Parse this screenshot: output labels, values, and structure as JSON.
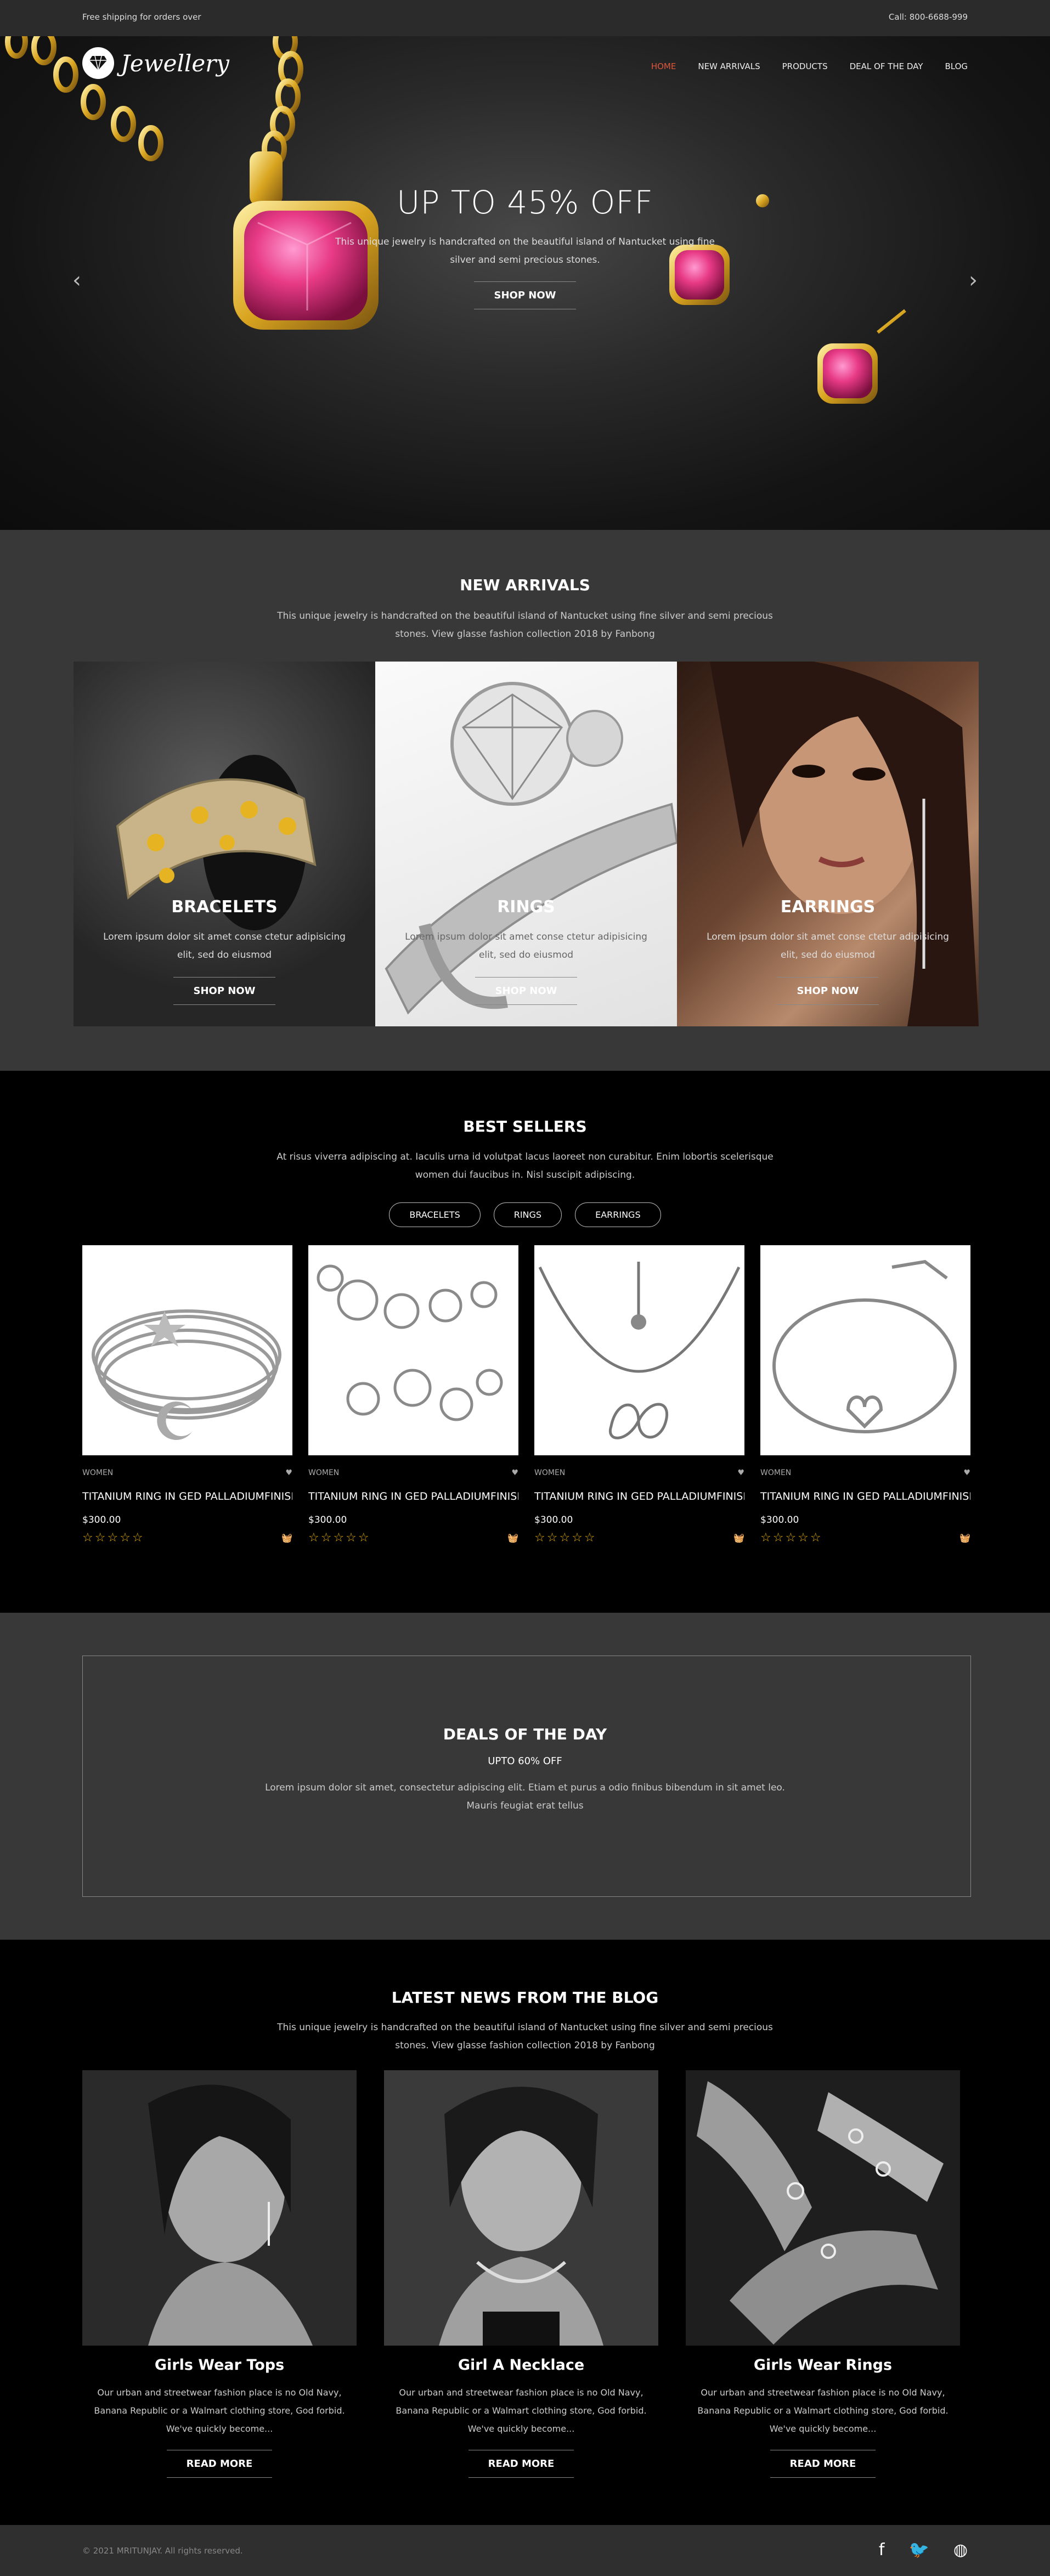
{
  "topbar": {
    "shipping": "Free shipping for orders over",
    "phone": "Call: 800-6688-999"
  },
  "logo": {
    "text": "Jewellery",
    "icon": "diamond-icon"
  },
  "nav": [
    {
      "label": "HOME",
      "active": true
    },
    {
      "label": "NEW ARRIVALS"
    },
    {
      "label": "PRODUCTS"
    },
    {
      "label": "DEAL OF THE DAY"
    },
    {
      "label": "BLOG"
    }
  ],
  "hero": {
    "title": "UP TO 45% OFF",
    "desc": "This unique jewelry is handcrafted on the beautiful island of Nantucket using fine silver and semi precious stones.",
    "button": "SHOP NOW",
    "prev_icon": "chevron-left-icon",
    "next_icon": "chevron-right-icon"
  },
  "new_arrivals": {
    "title": "NEW ARRIVALS",
    "desc": "This unique jewelry is handcrafted on the beautiful island of Nantucket using fine silver and semi precious stones. View glasse fashion collection 2018 by Fanbong",
    "cards": [
      {
        "title": "BRACELETS",
        "desc": "Lorem ipsum dolor sit amet conse ctetur adipisicing elit, sed do eiusmod",
        "button": "SHOP NOW"
      },
      {
        "title": "RINGS",
        "desc": "Lorem ipsum dolor sit amet conse ctetur adipisicing elit, sed do eiusmod",
        "button": "SHOP NOW"
      },
      {
        "title": "EARRINGS",
        "desc": "Lorem ipsum dolor sit amet conse ctetur adipisicing elit, sed do eiusmod",
        "button": "SHOP NOW"
      }
    ]
  },
  "best_sellers": {
    "title": "BEST SELLERS",
    "desc": "At risus viverra adipiscing at. Iaculis urna id volutpat lacus laoreet non curabitur. Enim lobortis scelerisque women dui faucibus in. Nisl suscipit adipiscing.",
    "filters": [
      "BRACELETS",
      "RINGS",
      "EARRINGS"
    ],
    "products": [
      {
        "category": "WOMEN",
        "name": "TITANIUM RING IN GED PALLADIUMFINISH ...",
        "price": "$300.00",
        "stars": "☆☆☆☆☆"
      },
      {
        "category": "WOMEN",
        "name": "TITANIUM RING IN GED PALLADIUMFINISH ...",
        "price": "$300.00",
        "stars": "☆☆☆☆☆"
      },
      {
        "category": "WOMEN",
        "name": "TITANIUM RING IN GED PALLADIUMFINISH ...",
        "price": "$300.00",
        "stars": "☆☆☆☆☆"
      },
      {
        "category": "WOMEN",
        "name": "TITANIUM RING IN GED PALLADIUMFINISH ...",
        "price": "$300.00",
        "stars": "☆☆☆☆☆"
      }
    ]
  },
  "deals": {
    "title": "DEALS OF THE DAY",
    "subtitle": "UPTO 60% OFF",
    "desc": "Lorem ipsum dolor sit amet, consectetur adipiscing elit. Etiam et purus a odio finibus bibendum in sit amet leo. Mauris feugiat erat tellus"
  },
  "blog": {
    "title": "LATEST NEWS FROM THE BLOG",
    "desc": "This unique jewelry is handcrafted on the beautiful island of Nantucket using fine silver and semi precious stones. View glasse fashion collection 2018 by Fanbong",
    "posts": [
      {
        "title": "Girls Wear Tops",
        "desc": "Our urban and streetwear fashion place is no Old Navy, Banana Republic or a Walmart clothing store, God forbid. We've quickly become...",
        "button": "READ MORE"
      },
      {
        "title": "Girl A Necklace",
        "desc": "Our urban and streetwear fashion place is no Old Navy, Banana Republic or a Walmart clothing store, God forbid. We've quickly become...",
        "button": "READ MORE"
      },
      {
        "title": "Girls Wear Rings",
        "desc": "Our urban and streetwear fashion place is no Old Navy, Banana Republic or a Walmart clothing store, God forbid. We've quickly become...",
        "button": "READ MORE"
      }
    ]
  },
  "footer": {
    "copyright": "© 2021 MRITUNJAY. All rights reserved.",
    "social": [
      "facebook-icon",
      "twitter-icon",
      "dribbble-icon"
    ]
  },
  "colors": {
    "accent": "#e0563b",
    "star": "#e8b000",
    "page_bg": "#000000",
    "section_grey": "#383838"
  }
}
